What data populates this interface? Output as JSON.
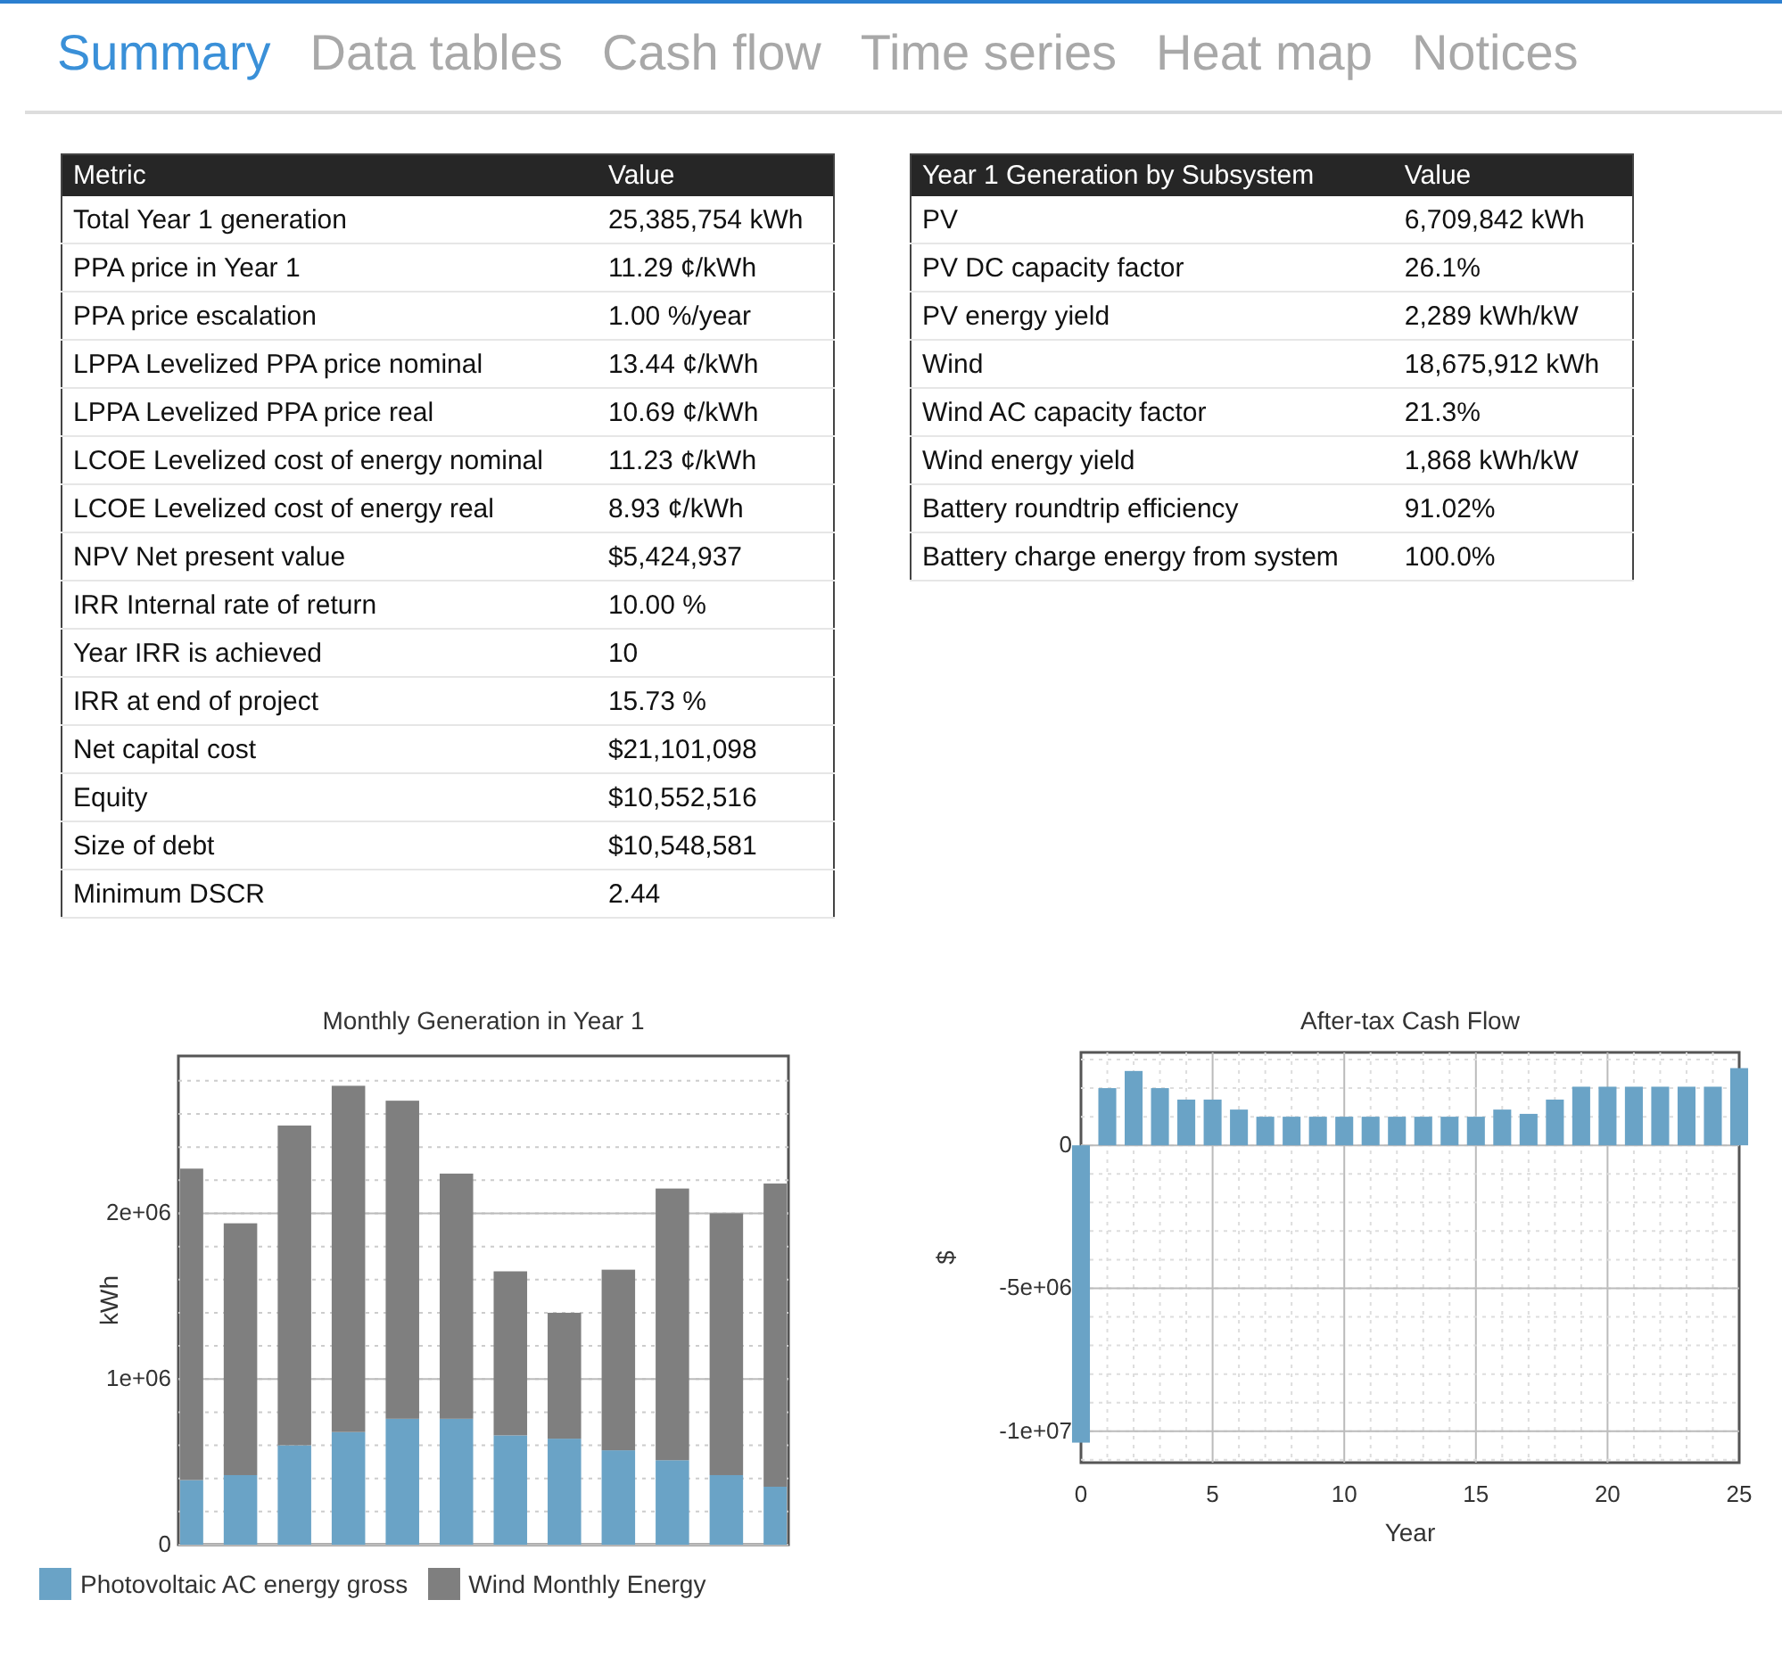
{
  "tabs": [
    {
      "label": "Summary",
      "selected": true
    },
    {
      "label": "Data tables",
      "selected": false
    },
    {
      "label": "Cash flow",
      "selected": false
    },
    {
      "label": "Time series",
      "selected": false
    },
    {
      "label": "Heat map",
      "selected": false
    },
    {
      "label": "Notices",
      "selected": false
    }
  ],
  "metrics_table": {
    "columns": [
      "Metric",
      "Value"
    ],
    "rows": [
      [
        "Total Year 1 generation",
        "25,385,754 kWh"
      ],
      [
        "PPA price in Year 1",
        "11.29 ¢/kWh"
      ],
      [
        "PPA price escalation",
        "1.00 %/year"
      ],
      [
        "LPPA Levelized PPA price nominal",
        "13.44 ¢/kWh"
      ],
      [
        "LPPA Levelized PPA price real",
        "10.69 ¢/kWh"
      ],
      [
        "LCOE Levelized cost of energy nominal",
        "11.23 ¢/kWh"
      ],
      [
        "LCOE Levelized cost of energy real",
        "8.93 ¢/kWh"
      ],
      [
        "NPV Net present value",
        "$5,424,937"
      ],
      [
        "IRR Internal rate of return",
        "10.00 %"
      ],
      [
        "Year IRR is achieved",
        "10"
      ],
      [
        "IRR at end of project",
        "15.73 %"
      ],
      [
        "Net capital cost",
        "$21,101,098"
      ],
      [
        "Equity",
        "$10,552,516"
      ],
      [
        "Size of debt",
        "$10,548,581"
      ],
      [
        "Minimum DSCR",
        "2.44"
      ]
    ]
  },
  "subsystem_table": {
    "columns": [
      "Year 1 Generation by Subsystem",
      "Value"
    ],
    "rows": [
      [
        "PV",
        "6,709,842 kWh"
      ],
      [
        "PV DC capacity factor",
        "26.1%"
      ],
      [
        "PV energy yield",
        "2,289 kWh/kW"
      ],
      [
        "Wind",
        "18,675,912 kWh"
      ],
      [
        "Wind AC capacity factor",
        "21.3%"
      ],
      [
        "Wind energy yield",
        "1,868 kWh/kW"
      ],
      [
        "Battery roundtrip efficiency",
        "91.02%"
      ],
      [
        "Battery charge energy from system",
        "100.0%"
      ]
    ]
  },
  "generation_chart": {
    "chart_data": {
      "type": "bar",
      "title": "Monthly Generation in Year 1",
      "ylabel": "kWh",
      "stacked": true,
      "grid": true,
      "legend": "bottom",
      "ylim": [
        0,
        2950000
      ],
      "yticks": [
        {
          "value": 0,
          "label": "0"
        },
        {
          "value": 1000000,
          "label": "1e+06"
        },
        {
          "value": 2000000,
          "label": "2e+06"
        }
      ],
      "series": [
        {
          "name": "Photovoltaic AC energy gross",
          "color": "#6aa3c6",
          "values": [
            390000,
            420000,
            600000,
            680000,
            760000,
            760000,
            660000,
            640000,
            570000,
            510000,
            420000,
            350000
          ]
        },
        {
          "name": "Wind Monthly Energy",
          "color": "#7f7f7f",
          "values": [
            1880000,
            1520000,
            1930000,
            2090000,
            1920000,
            1480000,
            990000,
            760000,
            1090000,
            1640000,
            1580000,
            1830000
          ]
        }
      ]
    }
  },
  "cashflow_chart": {
    "chart_data": {
      "type": "bar",
      "grid": true,
      "title": "After-tax Cash Flow",
      "xlabel": "Year",
      "ylabel": "$",
      "xlim": [
        0,
        25
      ],
      "ylim": [
        -11100000,
        3250000
      ],
      "xticks": [
        0,
        5,
        10,
        15,
        20,
        25
      ],
      "yticks": [
        {
          "value": 0,
          "label": "0"
        },
        {
          "value": -5000000,
          "label": "-5e+06"
        },
        {
          "value": -10000000,
          "label": "-1e+07"
        }
      ],
      "x": [
        0,
        1,
        2,
        3,
        4,
        5,
        6,
        7,
        8,
        9,
        10,
        11,
        12,
        13,
        14,
        15,
        16,
        17,
        18,
        19,
        20,
        21,
        22,
        23,
        24,
        25
      ],
      "series": [
        {
          "color": "#6aa3c6",
          "values": [
            -10400000,
            2000000,
            2600000,
            2000000,
            1600000,
            1600000,
            1250000,
            1000000,
            1000000,
            1000000,
            1000000,
            1000000,
            1000000,
            1000000,
            1000000,
            1000000,
            1250000,
            1100000,
            1600000,
            2050000,
            2050000,
            2050000,
            2050000,
            2050000,
            2050000,
            2700000
          ]
        }
      ]
    }
  }
}
